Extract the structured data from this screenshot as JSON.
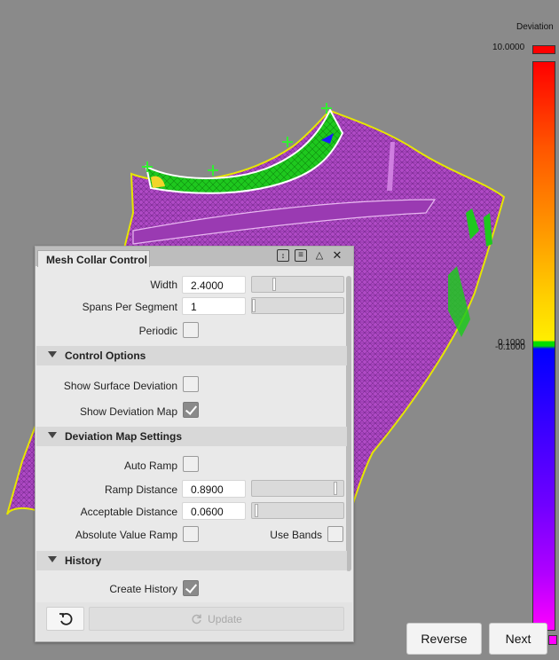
{
  "legend": {
    "title": "Deviation",
    "max_value": "10.0000",
    "mid_upper": "0.1000",
    "mid_lower": "-0.1000",
    "colors": {
      "max": "#ff0000",
      "in_tolerance": "#00dd00",
      "min": "#ff00ff"
    }
  },
  "panel": {
    "title": "Mesh Collar Control",
    "header_icons": [
      "dock-icon",
      "menu-icon",
      "collapse-icon",
      "close-icon"
    ],
    "width_label": "Width",
    "width_value": "2.4000",
    "spans_label": "Spans Per Segment",
    "spans_value": "1",
    "periodic_label": "Periodic",
    "periodic_checked": false,
    "control_options": {
      "title": "Control Options",
      "show_surface_deviation_label": "Show Surface Deviation",
      "show_surface_deviation_checked": false,
      "show_deviation_map_label": "Show Deviation Map",
      "show_deviation_map_checked": true
    },
    "deviation_map_settings": {
      "title": "Deviation Map Settings",
      "auto_ramp_label": "Auto Ramp",
      "auto_ramp_checked": false,
      "ramp_distance_label": "Ramp Distance",
      "ramp_distance_value": "0.8900",
      "acceptable_distance_label": "Acceptable Distance",
      "acceptable_distance_value": "0.0600",
      "absolute_value_ramp_label": "Absolute Value Ramp",
      "absolute_value_ramp_checked": false,
      "use_bands_label": "Use Bands",
      "use_bands_checked": false
    },
    "history": {
      "title": "History",
      "create_history_label": "Create History",
      "create_history_checked": true
    },
    "update_label": "Update"
  },
  "nav": {
    "reverse_label": "Reverse",
    "next_label": "Next"
  }
}
